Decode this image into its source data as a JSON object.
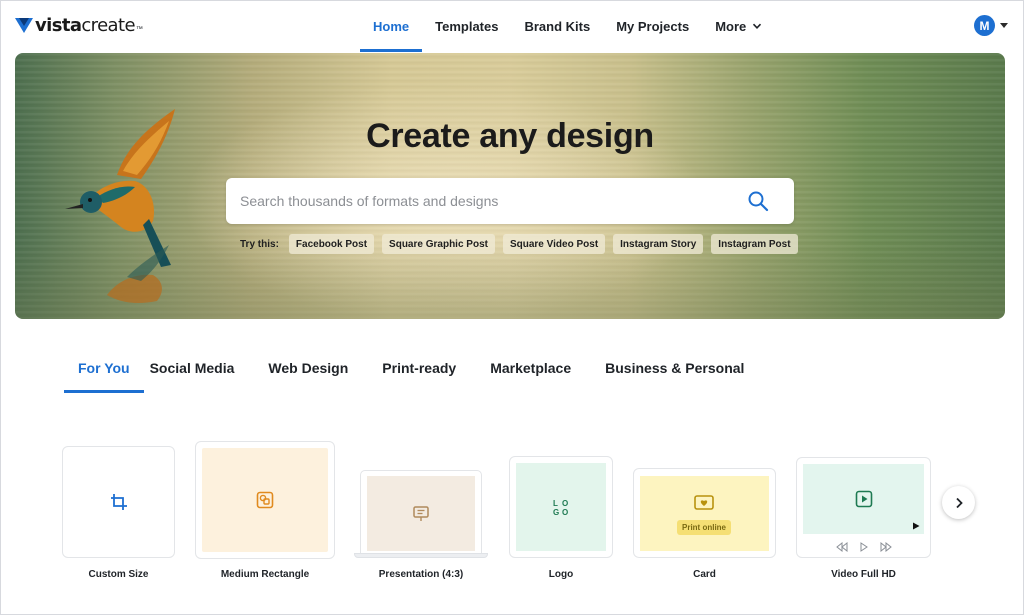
{
  "brand": {
    "name_bold": "vista",
    "name_regular": "create",
    "tm": "™"
  },
  "nav": {
    "items": [
      {
        "label": "Home",
        "active": true
      },
      {
        "label": "Templates"
      },
      {
        "label": "Brand Kits"
      },
      {
        "label": "My Projects"
      },
      {
        "label": "More"
      }
    ]
  },
  "user": {
    "avatar_initial": "M"
  },
  "hero": {
    "title": "Create any design",
    "search_placeholder": "Search thousands of formats and designs",
    "try_label": "Try this:",
    "suggestions": [
      "Facebook Post",
      "Square Graphic Post",
      "Square Video Post",
      "Instagram Story",
      "Instagram Post"
    ]
  },
  "tabs": [
    {
      "label": "For You",
      "active": true
    },
    {
      "label": "Social Media"
    },
    {
      "label": "Web Design"
    },
    {
      "label": "Print-ready"
    },
    {
      "label": "Marketplace"
    },
    {
      "label": "Business & Personal"
    }
  ],
  "formats": [
    {
      "label": "Custom Size",
      "icon": "crop-icon"
    },
    {
      "label": "Medium Rectangle",
      "icon": "image-shapes-icon"
    },
    {
      "label": "Presentation (4:3)",
      "icon": "presentation-icon"
    },
    {
      "label": "Logo",
      "icon": "logo-letters-icon"
    },
    {
      "label": "Card",
      "icon": "heart-card-icon",
      "badge": "Print online"
    },
    {
      "label": "Video Full HD",
      "icon": "play-icon"
    }
  ],
  "colors": {
    "accent": "#1d6fd1"
  }
}
